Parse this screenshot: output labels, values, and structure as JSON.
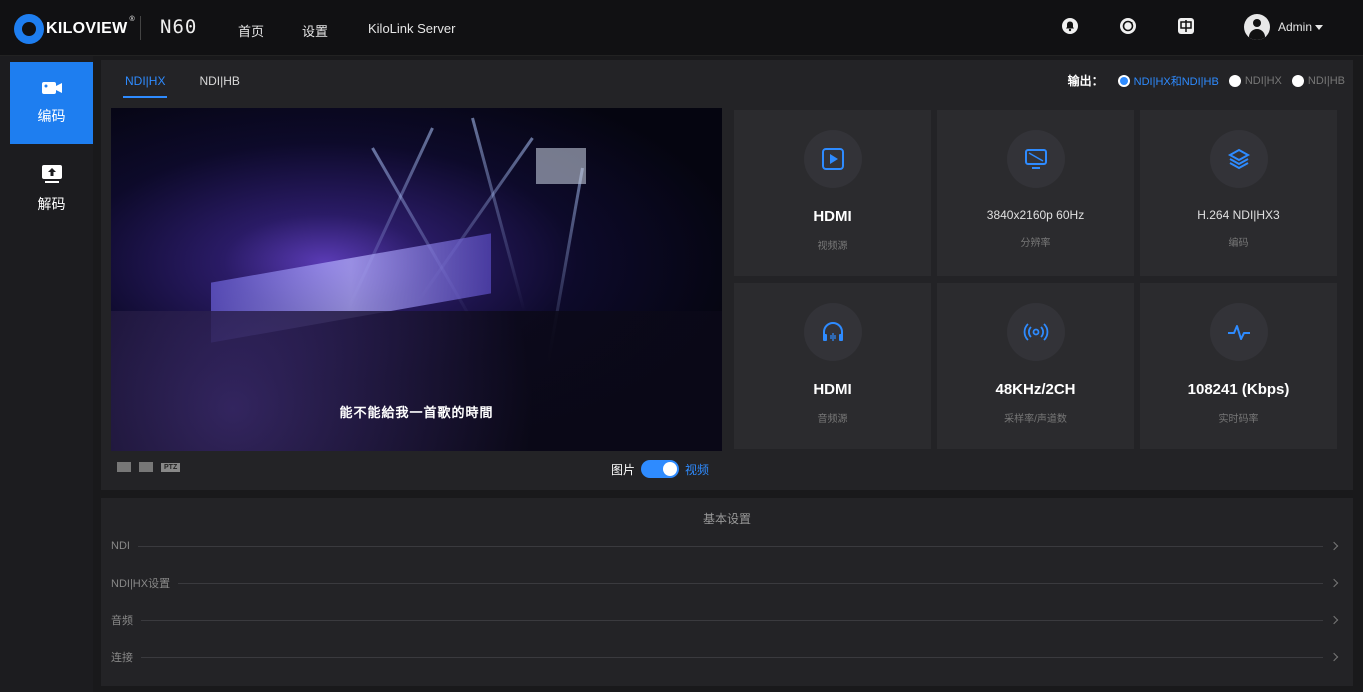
{
  "header": {
    "brand": "KILOVIEW",
    "model": "N60",
    "nav": [
      "首页",
      "设置",
      "KiloLink Server"
    ],
    "user": "Admin",
    "icons": [
      "notification-icon",
      "refresh-icon",
      "language-icon"
    ]
  },
  "sidebar": {
    "items": [
      {
        "label": "编码",
        "icon": "camera-icon",
        "active": true
      },
      {
        "label": "解码",
        "icon": "monitor-upload-icon",
        "active": false
      }
    ]
  },
  "main": {
    "tabs": [
      {
        "label": "NDI|HX",
        "active": true
      },
      {
        "label": "NDI|HB",
        "active": false
      }
    ],
    "output": {
      "label": "输出：",
      "options": [
        {
          "label": "NDI|HX和NDI|HB",
          "selected": true
        },
        {
          "label": "NDI|HX",
          "selected": false
        },
        {
          "label": "NDI|HB",
          "selected": false
        }
      ]
    },
    "preview": {
      "subtitle": "能不能給我一首歌的時間",
      "ptz_label": "PTZ",
      "switch_left": "图片",
      "switch_right": "视频"
    },
    "tiles": [
      {
        "value": "HDMI",
        "label": "视频源",
        "icon": "video-file-icon"
      },
      {
        "value": "3840x2160p 60Hz",
        "label": "分辨率",
        "icon": "display-icon"
      },
      {
        "value": "H.264 NDI|HX3",
        "label": "编码",
        "icon": "layers-icon"
      },
      {
        "value": "HDMI",
        "label": "音频源",
        "icon": "headphones-icon"
      },
      {
        "value": "48KHz/2CH",
        "label": "采样率/声道数",
        "icon": "broadcast-icon"
      },
      {
        "value": "108241 (Kbps)",
        "label": "实时码率",
        "icon": "pulse-icon"
      }
    ]
  },
  "settings": {
    "title": "基本设置",
    "rows": [
      "NDI",
      "NDI|HX设置",
      "音频",
      "连接"
    ]
  },
  "colors": {
    "accent": "#1e7ef0",
    "background": "#19191b",
    "panel": "#232326",
    "tile": "#2b2b2e"
  }
}
